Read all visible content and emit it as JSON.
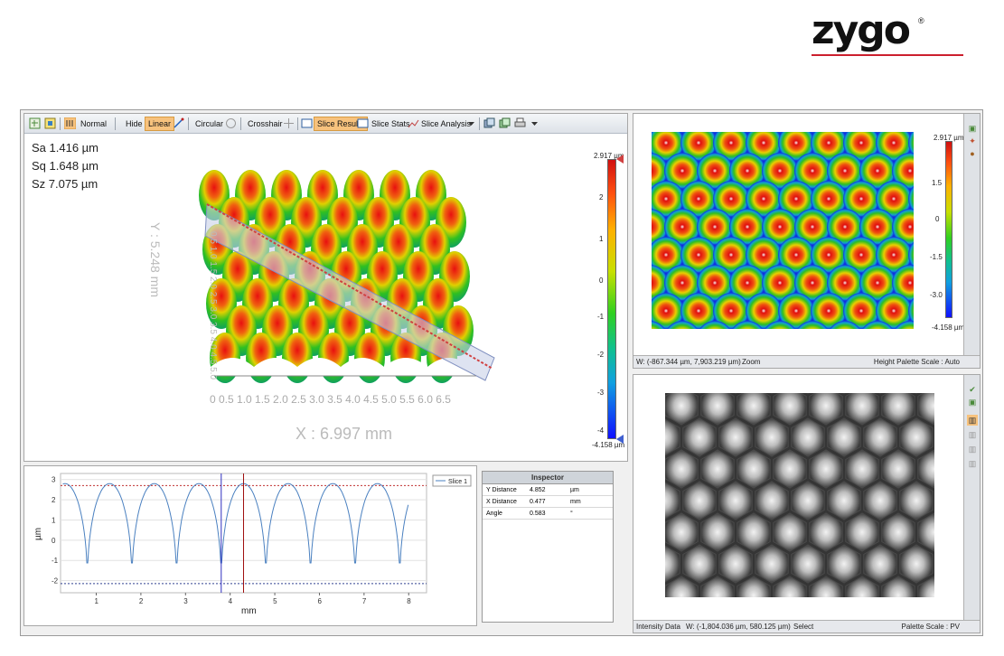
{
  "logo": {
    "text": "zygo",
    "mark": "®"
  },
  "toolbar": {
    "items": [
      {
        "label": "Normal"
      },
      {
        "label": "Hide"
      },
      {
        "label": "Linear",
        "active": true
      },
      {
        "label": "Circular"
      },
      {
        "label": "Crosshair"
      },
      {
        "label": "Slice Results",
        "active": true
      },
      {
        "label": "Slice Stats"
      },
      {
        "label": "Slice Analysis"
      }
    ]
  },
  "stats": {
    "sa": "Sa 1.416 µm",
    "sq": "Sq 1.648 µm",
    "sz": "Sz 7.075 µm"
  },
  "view3d": {
    "x_label": "X : 6.997 mm",
    "y_label": "Y : 5.248 mm",
    "x_ticks": "0  0.5 1.0 1.5 2.0 2.5 3.0 3.5 4.0 4.5 5.0 5.5 6.0 6.5",
    "y_ticks": "0.5 1.0 1.5 2.0 2.5 3.0 3.5 4.0 4.5 5.0",
    "colorbar": {
      "max": "2.917 µm",
      "min": "-4.158 µm",
      "ticks": [
        "2",
        "1",
        "0",
        "-1",
        "-2",
        "-3",
        "-4"
      ]
    }
  },
  "slice": {
    "legend": "Slice 1",
    "xlabel": "mm",
    "ylabel": "µm",
    "xticks": [
      "1",
      "2",
      "3",
      "4",
      "5",
      "6",
      "7",
      "8"
    ],
    "yticks": [
      "3",
      "2",
      "1",
      "0",
      "-1",
      "-2"
    ]
  },
  "chart_data": {
    "type": "line",
    "series": [
      {
        "name": "Slice 1"
      }
    ],
    "xlabel": "mm",
    "ylabel": "µm",
    "xlim": [
      0.2,
      8.4
    ],
    "ylim": [
      -2.6,
      3.3
    ],
    "peak_value": 2.8,
    "valley_value": -2.1,
    "valley_x": [
      1.8,
      2.8,
      3.8,
      4.8,
      5.8,
      6.8,
      7.8
    ],
    "ref_lines": {
      "upper": 2.7,
      "lower": -2.15
    },
    "cursor_x": [
      3.8,
      4.3
    ]
  },
  "inspector": {
    "title": "Inspector",
    "rows": [
      {
        "name": "Y Distance",
        "value": "4.852",
        "unit": "µm"
      },
      {
        "name": "X Distance",
        "value": "0.477",
        "unit": "mm"
      },
      {
        "name": "Angle",
        "value": "0.583",
        "unit": "°"
      }
    ]
  },
  "height": {
    "colorbar": {
      "max": "2.917 µm",
      "min": "-4.158 µm",
      "ticks": [
        "1.5",
        "0",
        "-1.5",
        "-3.0"
      ]
    },
    "status": {
      "coords": "W: (-867.344 µm, 7,903.219 µm)",
      "mode": "Zoom",
      "palette": "Height Palette Scale : Auto"
    }
  },
  "intensity": {
    "status": {
      "label": "Intensity Data",
      "coords": "W: (-1,804.036 µm, 580.125 µm)",
      "mode": "Select",
      "palette": "Palette Scale : PV"
    }
  },
  "colors": {
    "accent": "#f7c27d",
    "logo_line": "#cc1f2d"
  }
}
